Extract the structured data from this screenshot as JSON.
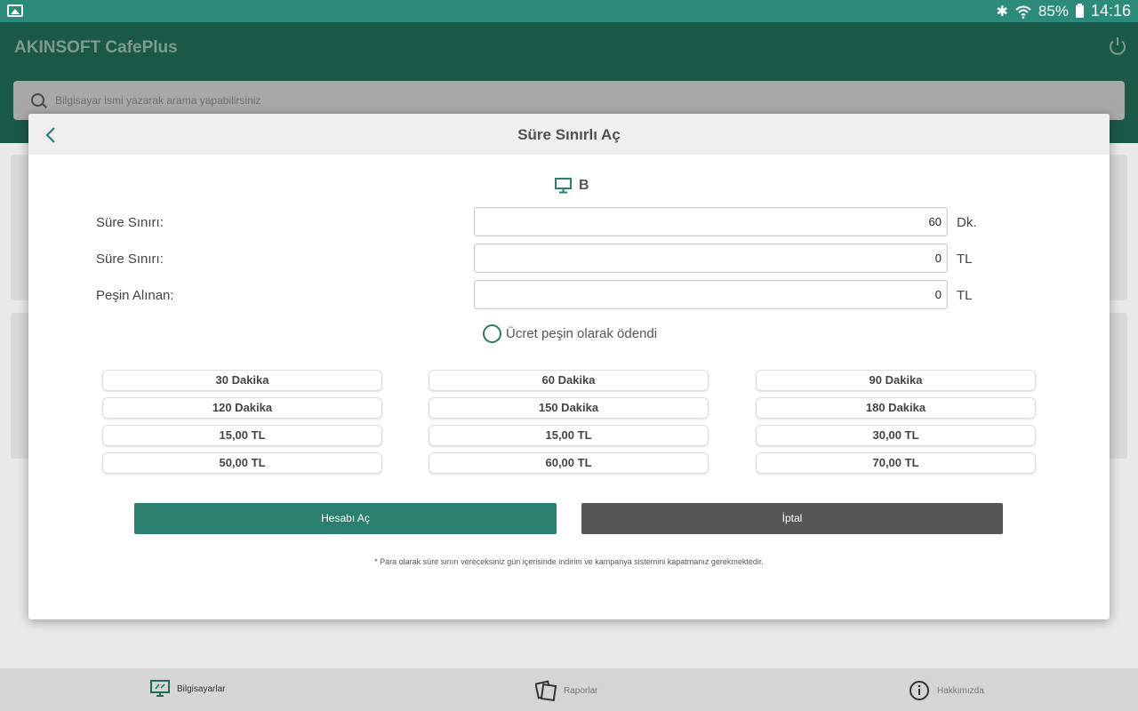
{
  "status_bar": {
    "battery": "85%",
    "time": "14:16"
  },
  "app": {
    "title": "AKINSOFT CafePlus",
    "search_placeholder": "Bilgisayar ismi yazarak arama yapabilirsiniz"
  },
  "dialog": {
    "title": "Süre Sınırlı Aç",
    "computer_name": "B",
    "rows": [
      {
        "label": "Süre Sınırı:",
        "value": "60",
        "unit": "Dk."
      },
      {
        "label": "Süre Sınırı:",
        "value": "0",
        "unit": "TL"
      },
      {
        "label": "Peşin Alınan:",
        "value": "0",
        "unit": "TL"
      }
    ],
    "paid_checkbox_label": "Ücret peşin olarak ödendi",
    "presets": [
      "30 Dakika",
      "60 Dakika",
      "90 Dakika",
      "120 Dakika",
      "150 Dakika",
      "180 Dakika",
      "15,00 TL",
      "15,00 TL",
      "30,00 TL",
      "50,00 TL",
      "60,00 TL",
      "70,00 TL"
    ],
    "open_button": "Hesabı Aç",
    "cancel_button": "İptal",
    "note": "* Para olarak süre sınırı vereceksiniz gün içerisinde indirim ve kampanya sistemini kapatmanız gerekmektedir."
  },
  "bottom_nav": [
    {
      "label": "Bilgisayarlar",
      "icon": "computer-icon"
    },
    {
      "label": "Raporlar",
      "icon": "reports-icon"
    },
    {
      "label": "Hakkımızda",
      "icon": "info-icon"
    }
  ],
  "colors": {
    "accent": "#2a7f6e",
    "status_bar": "#2c8b78",
    "cancel": "#565656"
  }
}
